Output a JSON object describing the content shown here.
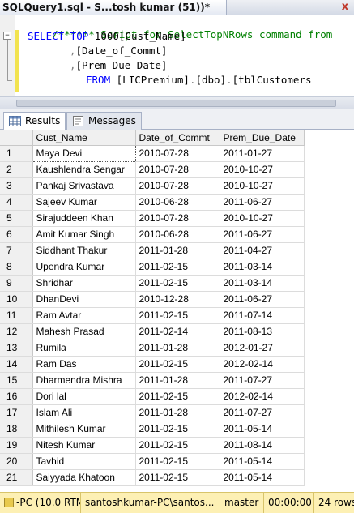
{
  "window": {
    "tab_title": "SQLQuery1.sql - S...tosh kumar (51))*",
    "close_symbol": "x"
  },
  "editor": {
    "lines": [
      {
        "comment": "/****** Script for SelectTopNRows command from"
      },
      {
        "kw1": "SELECT TOP ",
        "num": "1000",
        "rest": "[Cust_Name]"
      },
      {
        "comma": ",",
        "rest": "[Date_of_Commt]"
      },
      {
        "comma": ",",
        "rest": "[Prem_Due_Date]"
      },
      {
        "kw1": "FROM ",
        "rest": "[LICPremium]",
        "dot1": ".",
        "mid": "[dbo]",
        "dot2": ".",
        "tail": "[tblCustomers"
      }
    ]
  },
  "results_tabs": [
    {
      "label": "Results",
      "icon": "grid-icon",
      "active": true
    },
    {
      "label": "Messages",
      "icon": "messages-icon",
      "active": false
    }
  ],
  "grid": {
    "columns": [
      "",
      "Cust_Name",
      "Date_of_Commt",
      "Prem_Due_Date"
    ],
    "rows": [
      [
        "1",
        "Maya Devi",
        "2010-07-28",
        "2011-01-27"
      ],
      [
        "2",
        "Kaushlendra Sengar",
        "2010-07-28",
        "2010-10-27"
      ],
      [
        "3",
        "Pankaj Srivastava",
        "2010-07-28",
        "2010-10-27"
      ],
      [
        "4",
        "Sajeev Kumar",
        "2010-06-28",
        "2011-06-27"
      ],
      [
        "5",
        "Sirajuddeen Khan",
        "2010-07-28",
        "2010-10-27"
      ],
      [
        "6",
        "Amit Kumar Singh",
        "2010-06-28",
        "2011-06-27"
      ],
      [
        "7",
        "Siddhant Thakur",
        "2011-01-28",
        "2011-04-27"
      ],
      [
        "8",
        "Upendra Kumar",
        "2011-02-15",
        "2011-03-14"
      ],
      [
        "9",
        "Shridhar",
        "2011-02-15",
        "2011-03-14"
      ],
      [
        "10",
        "DhanDevi",
        "2010-12-28",
        "2011-06-27"
      ],
      [
        "11",
        "Ram Avtar",
        "2011-02-15",
        "2011-07-14"
      ],
      [
        "12",
        "Mahesh Prasad",
        "2011-02-14",
        "2011-08-13"
      ],
      [
        "13",
        "Rumila",
        "2011-01-28",
        "2012-01-27"
      ],
      [
        "14",
        "Ram Das",
        "2011-02-15",
        "2012-02-14"
      ],
      [
        "15",
        "Dharmendra Mishra",
        "2011-01-28",
        "2011-07-27"
      ],
      [
        "16",
        "Dori lal",
        "2011-02-15",
        "2012-02-14"
      ],
      [
        "17",
        "Islam Ali",
        "2011-01-28",
        "2011-07-27"
      ],
      [
        "18",
        "Mithilesh Kumar",
        "2011-02-15",
        "2011-05-14"
      ],
      [
        "19",
        "Nitesh Kumar",
        "2011-02-15",
        "2011-08-14"
      ],
      [
        "20",
        "Tavhid",
        "2011-02-15",
        "2011-05-14"
      ],
      [
        "21",
        "Saiyyada Khatoon",
        "2011-02-15",
        "2011-05-14"
      ]
    ]
  },
  "statusbar": {
    "server": "-PC (10.0 RTM)",
    "user": "santoshkumar-PC\\santos...",
    "database": "master",
    "elapsed": "00:00:00",
    "rows": "24 rows"
  },
  "colors": {
    "keyword": "#0000ff",
    "comment": "#008000",
    "status_bg": "#fdf0b4"
  }
}
